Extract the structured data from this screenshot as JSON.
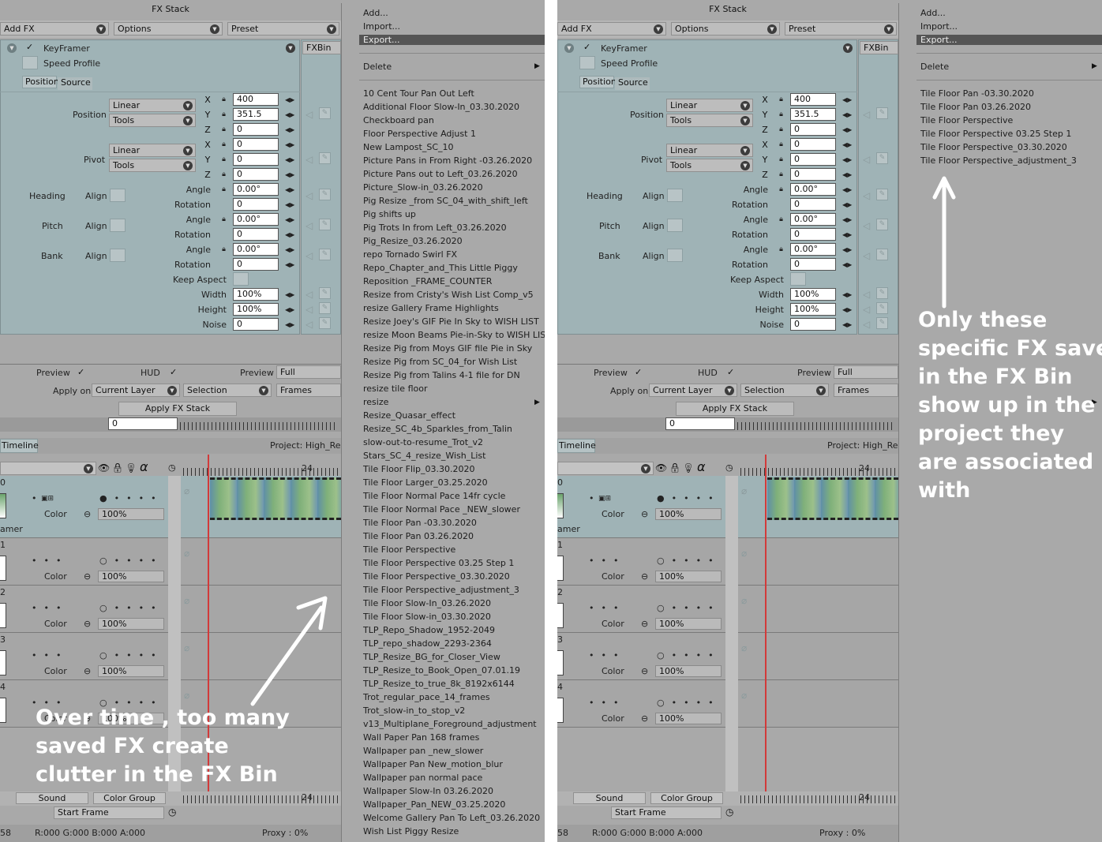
{
  "left": {
    "window_title": "FX Stack",
    "addfx_label": "Add FX",
    "options_label": "Options",
    "preset_label": "Preset",
    "fx_name": "KeyFramer",
    "speed_profile_label": "Speed Profile",
    "tab_position": "Position",
    "tab_source": "Source",
    "fxbin_label": "FXBin",
    "position_label": "Position",
    "pivot_label": "Pivot",
    "linear_label": "Linear",
    "tools_label": "Tools",
    "pos_x": "400",
    "pos_y": "351.5",
    "pos_z": "0",
    "piv_x": "0",
    "piv_y": "0",
    "piv_z": "0",
    "axis_x": "X",
    "axis_y": "Y",
    "axis_z": "Z",
    "heading_label": "Heading",
    "pitch_label": "Pitch",
    "bank_label": "Bank",
    "align_label": "Align",
    "angle_label": "Angle",
    "rotation_label": "Rotation",
    "heading_angle": "0.00°",
    "heading_rotation": "0",
    "pitch_angle": "0.00°",
    "pitch_rotation": "0",
    "bank_angle": "0.00°",
    "bank_rotation": "0",
    "keep_aspect_label": "Keep Aspect",
    "width_label": "Width",
    "height_label": "Height",
    "noise_label": "Noise",
    "width_val": "100%",
    "height_val": "100%",
    "noise_val": "0",
    "preview_label": "Preview",
    "hud_label": "HUD",
    "preview2_label": "Preview",
    "full_label": "Full",
    "apply_on_label": "Apply on",
    "current_layer_label": "Current Layer",
    "selection_label": "Selection",
    "frames_label": "Frames",
    "apply_fx_label": "Apply FX Stack",
    "frame_field": "0",
    "timeline_tab": "Timeline",
    "project_label": "Project: High_Res",
    "frame_marker": "24",
    "layer_label": "Color",
    "layer_pct": "100%",
    "layer0_num": "0",
    "layer0_name": "amer",
    "layer1_num": "1",
    "layer2_num": "2",
    "layer3_num": "3",
    "layer4_num": "4",
    "sound_label": "Sound",
    "color_group_label": "Color Group",
    "start_frame_label": "Start Frame",
    "status_frame": "58",
    "status_rgba": "R:000 G:000 B:000 A:000",
    "status_proxy": "Proxy : 0%"
  },
  "menu_left": {
    "add": "Add...",
    "import": "Import...",
    "export": "Export...",
    "delete": "Delete",
    "items": [
      "10 Cent Tour Pan Out Left",
      "Additional Floor Slow-In_03.30.2020",
      "Checkboard pan",
      "Floor Perspective Adjust 1",
      "New Lampost_SC_10",
      "Picture Pans in From Right -03.26.2020",
      "Picture Pans out to Left_03.26.2020",
      "Picture_Slow-in_03.26.2020",
      "Pig Resize _from SC_04_with_shift_left",
      "Pig shifts up",
      "Pig Trots In from Left_03.26.2020",
      "Pig_Resize_03.26.2020",
      "repo Tornado Swirl FX",
      "Repo_Chapter_and_This Little Piggy",
      "Reposition _FRAME_COUNTER",
      "Resize from Cristy's Wish List Comp_v5",
      "resize Gallery Frame Highlights",
      "Resize Joey's GIF  Pie In Sky to WISH LIST",
      "resize Moon Beams Pie-in-Sky to WISH LIST",
      "Resize Pig from Moys GIF file Pie in Sky",
      "Resize Pig from SC_04_for Wish List",
      "Resize Pig from Talins  4-1 file for DN",
      "resize tile floor",
      "resize",
      "Resize_Quasar_effect",
      "Resize_SC_4b_Sparkles_from_Talin",
      "slow-out-to-resume_Trot_v2",
      "Stars_SC_4_resize_Wish_List",
      "Tile Floor Flip_03.30.2020",
      "Tile Floor Larger_03.25.2020",
      "Tile Floor Normal Pace 14fr cycle",
      "Tile Floor Normal Pace _NEW_slower",
      "Tile Floor Pan -03.30.2020",
      "Tile Floor Pan 03.26.2020",
      "Tile Floor Perspective",
      "Tile Floor Perspective 03.25 Step 1",
      "Tile Floor Perspective_03.30.2020",
      "Tile Floor Perspective_adjustment_3",
      "Tile Floor Slow-In_03.26.2020",
      "Tile Floor Slow-in_03.30.2020",
      "TLP_Repo_Shadow_1952-2049",
      "TLP_repo_shadow_2293-2364",
      "TLP_Resize_BG_for_Closer_View",
      "TLP_Resize_to_Book_Open_07.01.19",
      "TLP_Resize_to_true_8k_8192x6144",
      "Trot_regular_pace_14_frames",
      "Trot_slow-in_to_stop_v2",
      "v13_Multiplane_Foreground_adjustment",
      "Wall Paper Pan 168 frames",
      "Wallpaper pan _new_slower",
      "Wallpaper Pan New_motion_blur",
      "Wallpaper pan normal pace",
      "Wallpaper Slow-In 03.26.2020",
      "Wallpaper_Pan_NEW_03.25.2020",
      "Welcome Gallery Pan To Left_03.26.2020",
      "Wish List Piggy Resize"
    ]
  },
  "menu_right": {
    "add": "Add...",
    "import": "Import...",
    "export": "Export...",
    "delete": "Delete",
    "items": [
      "Tile Floor Pan -03.30.2020",
      "Tile Floor Pan 03.26.2020",
      "Tile Floor Perspective",
      "Tile Floor Perspective 03.25 Step 1",
      "Tile Floor Perspective_03.30.2020",
      "Tile Floor Perspective_adjustment_3"
    ]
  },
  "annotations": {
    "left_lines": [
      "Over time , too many",
      "saved FX create",
      "clutter in the FX Bin"
    ],
    "right_lines": [
      "Only these",
      "specific FX saved",
      "in the FX Bin",
      "show up in the",
      "project they",
      "are associated",
      "with"
    ]
  },
  "colors": {
    "panel": "#a9a9a9",
    "teal": "#9fb3b6",
    "highlight": "#555555",
    "timeline_red": "#d23a3a"
  },
  "icons": [
    "chevron-down-icon",
    "lock-icon",
    "stepper-icon",
    "check-icon",
    "keyframe-diamond-icon",
    "wrench-icon",
    "eye-icon",
    "alpha-icon",
    "clock-icon",
    "arrow-icon"
  ]
}
